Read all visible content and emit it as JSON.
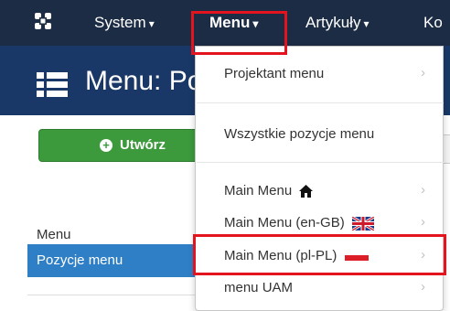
{
  "navbar": {
    "items": [
      {
        "label": "System"
      },
      {
        "label": "Menu"
      },
      {
        "label": "Artykuły"
      },
      {
        "label": "Ko"
      }
    ],
    "caret": "▾"
  },
  "title": {
    "text": "Menu: Po"
  },
  "toolbar": {
    "new_label": "Utwórz"
  },
  "sidebar": {
    "heading": "Menu",
    "active_item": "Pozycje menu"
  },
  "dropdown": {
    "items": [
      {
        "label": "Projektant menu",
        "submenu": true
      },
      {
        "label": "Wszystkie pozycje menu",
        "submenu": false
      },
      {
        "label": "Main Menu",
        "submenu": true,
        "icon": "home-icon"
      },
      {
        "label": "Main Menu (en-GB)",
        "submenu": true,
        "icon": "uk-flag-icon"
      },
      {
        "label": "Main Menu (pl-PL)",
        "submenu": true,
        "icon": "pl-flag-icon",
        "highlighted": true
      },
      {
        "label": "menu UAM",
        "submenu": true
      }
    ],
    "arrow": "›"
  },
  "colors": {
    "navbar": "#1c2c44",
    "titlebar": "#1a3867",
    "highlight": "#e3141d",
    "success": "#3c9a3c",
    "active": "#2f7fc6"
  }
}
